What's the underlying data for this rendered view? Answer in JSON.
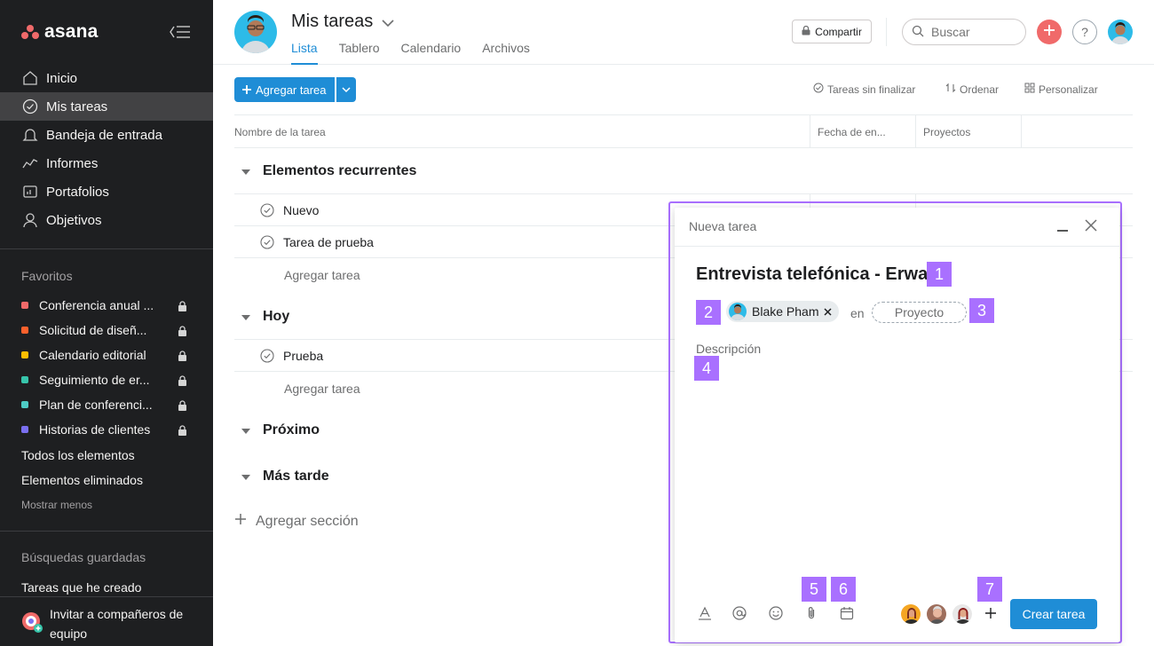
{
  "app": {
    "logo_text": "asana"
  },
  "sidebar": {
    "nav": [
      {
        "label": "Inicio",
        "icon": "home-icon"
      },
      {
        "label": "Mis tareas",
        "icon": "check-circle-icon",
        "active": true
      },
      {
        "label": "Bandeja de entrada",
        "icon": "bell-icon"
      },
      {
        "label": "Informes",
        "icon": "chart-line-icon"
      },
      {
        "label": "Portafolios",
        "icon": "folder-icon"
      },
      {
        "label": "Objetivos",
        "icon": "person-icon"
      }
    ],
    "favorites_title": "Favoritos",
    "favorites": [
      {
        "label": "Conferencia anual ...",
        "color": "#f06a6a"
      },
      {
        "label": "Solicitud de diseñ...",
        "color": "#fd612c"
      },
      {
        "label": "Calendario editorial",
        "color": "#fcbd01"
      },
      {
        "label": "Seguimiento de er...",
        "color": "#37c5ab"
      },
      {
        "label": "Plan de conferenci...",
        "color": "#4ecbc4"
      },
      {
        "label": "Historias de clientes",
        "color": "#7a6ff0"
      }
    ],
    "all_items": "Todos los elementos",
    "deleted_items": "Elementos eliminados",
    "show_less": "Mostrar menos",
    "saved_searches_title": "Búsquedas guardadas",
    "saved_search_1": "Tareas que he creado",
    "invite": "Invitar a compañeros de equipo"
  },
  "header": {
    "title": "Mis tareas",
    "tabs": [
      "Lista",
      "Tablero",
      "Calendario",
      "Archivos"
    ],
    "share": "Compartir",
    "search_placeholder": "Buscar",
    "help": "?"
  },
  "toolbar": {
    "add_task": "Agregar tarea",
    "filter": "Tareas sin finalizar",
    "sort": "Ordenar",
    "customize": "Personalizar"
  },
  "table": {
    "columns": [
      "Nombre de la tarea",
      "Fecha de en...",
      "Proyectos"
    ],
    "sections": [
      {
        "name": "Elementos recurrentes",
        "tasks": [
          "Nuevo",
          "Tarea de prueba"
        ],
        "add": "Agregar tarea"
      },
      {
        "name": "Hoy",
        "tasks": [
          "Prueba"
        ],
        "add": "Agregar tarea"
      },
      {
        "name": "Próximo"
      },
      {
        "name": "Más tarde"
      }
    ],
    "add_section": "Agregar sección"
  },
  "modal": {
    "header": "Nueva tarea",
    "task_title": "Entrevista telefónica - Erwan",
    "assignee": "Blake Pham",
    "in_label": "en",
    "project_placeholder": "Proyecto",
    "description_placeholder": "Descripción",
    "create": "Crear tarea",
    "badges": [
      "1",
      "2",
      "3",
      "4",
      "5",
      "6",
      "7"
    ]
  },
  "colors": {
    "accent": "#1f8dd6",
    "highlight": "#a970ff",
    "sidebar_bg": "#1e1f21"
  }
}
